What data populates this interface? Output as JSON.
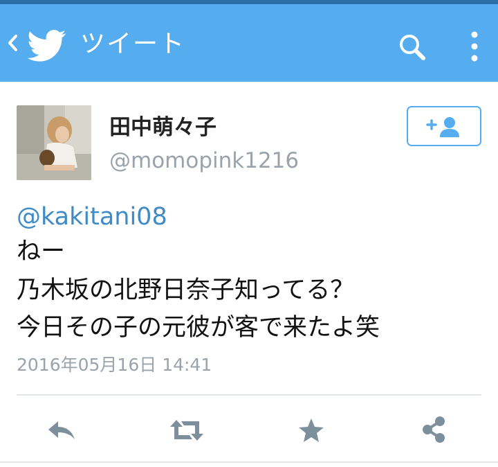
{
  "colors": {
    "header": "#55acee",
    "link": "#3f8bc7",
    "icon": "#7e8f9c"
  },
  "header": {
    "title": "ツイート",
    "icons": [
      "back-chevron-icon",
      "twitter-bird-icon",
      "search-icon",
      "more-vert-icon"
    ]
  },
  "tweet": {
    "user": {
      "display_name": "田中萌々子",
      "handle": "@momopink1216"
    },
    "mention": "@kakitani08",
    "lines": [
      "ねー",
      "乃木坂の北野日奈子知ってる？",
      "今日その子の元彼が客で来たよ笑"
    ],
    "timestamp": "2016年05月16日 14:41"
  },
  "actions": [
    "reply-icon",
    "retweet-icon",
    "favorite-star-icon",
    "share-icon"
  ]
}
